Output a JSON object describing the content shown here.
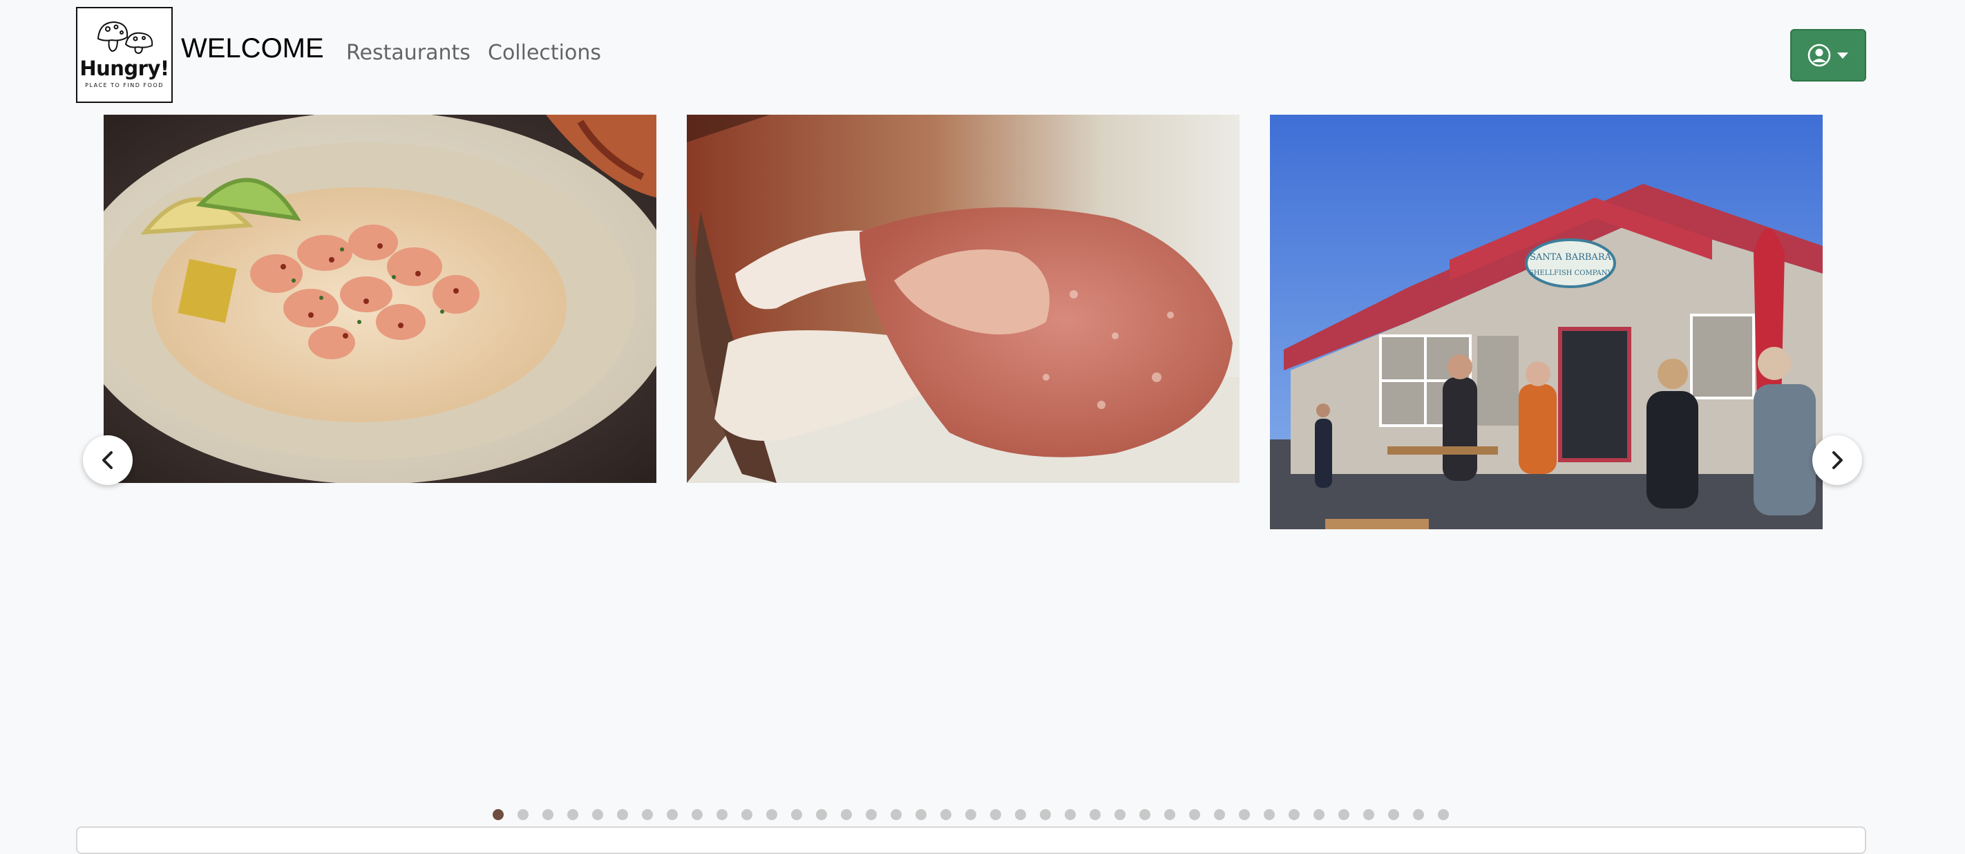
{
  "logo": {
    "title": "Hungry!",
    "tagline": "PLACE TO FIND FOOD"
  },
  "brand": {
    "text": "WELCOME"
  },
  "nav": [
    {
      "label": "Restaurants"
    },
    {
      "label": "Collections"
    }
  ],
  "user_menu": {
    "icon": "user-circle-icon",
    "caret_icon": "caret-down-icon"
  },
  "carousel": {
    "slides": [
      {
        "subject": "shrimp-over-rice-plate"
      },
      {
        "subject": "crab-claw"
      },
      {
        "subject": "seafood-shack-storefront",
        "sign_text": [
          "SANTA BARBARA",
          "SHELLFISH COMPANY"
        ]
      }
    ],
    "prev_icon": "chevron-left-icon",
    "next_icon": "chevron-right-icon",
    "dot_count": 39,
    "active_dot": 1
  },
  "colors": {
    "accent": "#3d8b5a",
    "active_dot": "#6f4d3f",
    "inactive_dot": "#c8c8c8",
    "background": "#f8f9fa"
  }
}
